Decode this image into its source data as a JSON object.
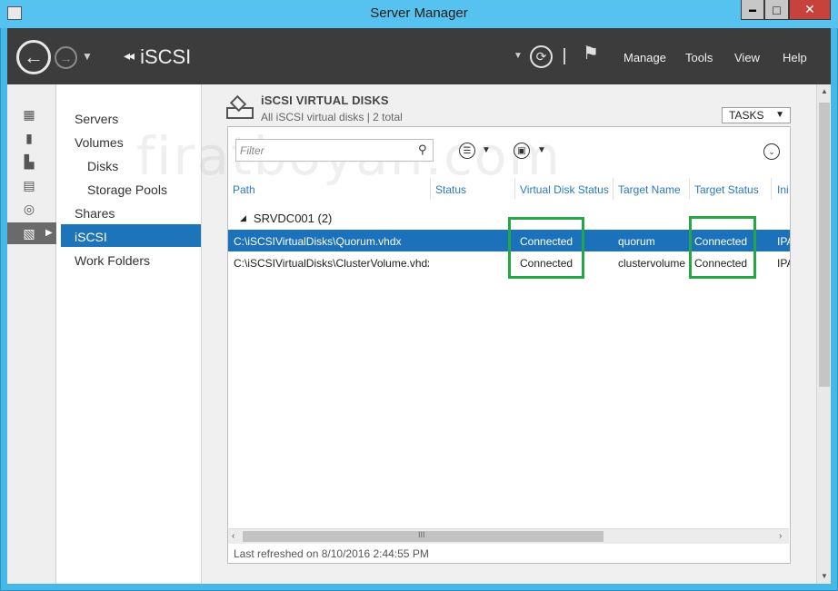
{
  "window": {
    "title": "Server Manager",
    "app_icon": "server-manager-icon",
    "controls": {
      "minimize": "▬",
      "maximize": "□",
      "close": "✕"
    }
  },
  "header": {
    "breadcrumb": "iSCSI",
    "breadcrumb_prefix": "◂◂",
    "menu": [
      "Manage",
      "Tools",
      "View",
      "Help"
    ]
  },
  "leftnav": {
    "icons": [
      "dashboard-icon",
      "local-server-icon",
      "all-servers-icon",
      "file-services-icon",
      "hyperv-icon",
      "file-storage-icon"
    ]
  },
  "subnav": {
    "items": [
      {
        "label": "Servers",
        "indent": false,
        "selected": false
      },
      {
        "label": "Volumes",
        "indent": false,
        "selected": false
      },
      {
        "label": "Disks",
        "indent": true,
        "selected": false
      },
      {
        "label": "Storage Pools",
        "indent": true,
        "selected": false
      },
      {
        "label": "Shares",
        "indent": false,
        "selected": false
      },
      {
        "label": "iSCSI",
        "indent": false,
        "selected": true
      },
      {
        "label": "Work Folders",
        "indent": false,
        "selected": false
      }
    ]
  },
  "panel": {
    "title": "iSCSI VIRTUAL DISKS",
    "subtitle": "All iSCSI virtual disks | 2 total",
    "tasks_label": "TASKS",
    "filter_placeholder": "Filter",
    "columns": [
      "Path",
      "Status",
      "Virtual Disk Status",
      "Target Name",
      "Target Status",
      "Ini"
    ],
    "group_label": "SRVDC001 (2)",
    "rows": [
      {
        "path": "C:\\iSCSIVirtualDisks\\Quorum.vhdx",
        "status": "",
        "vd_status": "Connected",
        "target_name": "quorum",
        "target_status": "Connected",
        "ini": "IPA",
        "selected": true
      },
      {
        "path": "C:\\iSCSIVirtualDisks\\ClusterVolume.vhdx",
        "status": "",
        "vd_status": "Connected",
        "target_name": "clustervolume",
        "target_status": "Connected",
        "ini": "IPA",
        "selected": false
      }
    ],
    "hscroll_grip": "III",
    "last_refreshed": "Last refreshed on 8/10/2016 2:44:55 PM"
  },
  "watermark": "firatboyan.com",
  "colors": {
    "titlebar": "#56c2ef",
    "header": "#3c3c3c",
    "selection": "#1b72ba",
    "highlight_box": "#27a646",
    "column_header": "#2a78bf"
  }
}
